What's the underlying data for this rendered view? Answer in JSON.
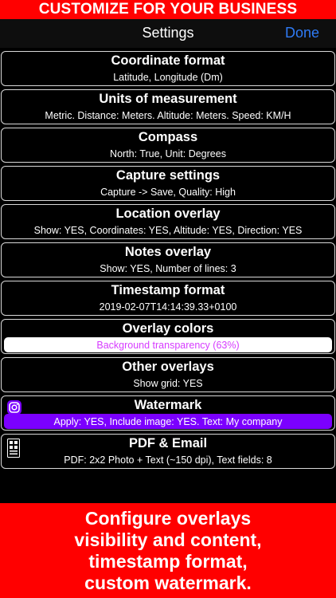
{
  "banner_top": "CUSTOMIZE FOR YOUR BUSINESS",
  "nav": {
    "title": "Settings",
    "done_label": "Done"
  },
  "rows": [
    {
      "title": "Coordinate format",
      "subtitle": "Latitude, Longitude (Dm)"
    },
    {
      "title": "Units of measurement",
      "subtitle": "Metric. Distance: Meters. Altitude: Meters. Speed: KM/H"
    },
    {
      "title": "Compass",
      "subtitle": "North: True, Unit: Degrees"
    },
    {
      "title": "Capture settings",
      "subtitle": "Capture -> Save, Quality: High"
    },
    {
      "title": "Location overlay",
      "subtitle": "Show: YES, Coordinates: YES, Altitude: YES, Direction: YES"
    },
    {
      "title": "Notes overlay",
      "subtitle": "Show: YES, Number of lines: 3"
    },
    {
      "title": "Timestamp format",
      "subtitle": "2019-02-07T14:14:39.33+0100"
    },
    {
      "title": "Overlay colors",
      "subtitle": "Background transparency (63%)"
    },
    {
      "title": "Other overlays",
      "subtitle": "Show grid: YES"
    },
    {
      "title": "Watermark",
      "subtitle": "Apply: YES, Include image: YES. Text: My company"
    },
    {
      "title": "PDF & Email",
      "subtitle": "PDF: 2x2 Photo + Text (~150 dpi), Text fields: 8"
    }
  ],
  "banner_bottom": {
    "lines": [
      "Configure overlays",
      "visibility and content,",
      "timestamp format,",
      "custom watermark."
    ]
  },
  "colors": {
    "banner": "#ff0000",
    "accent": "#2f7bf6",
    "overlay_text": "#d63cff",
    "watermark": "#7b00ff"
  },
  "icons": {
    "watermark": "instagram-icon",
    "pdf": "pdf-layout-icon"
  }
}
